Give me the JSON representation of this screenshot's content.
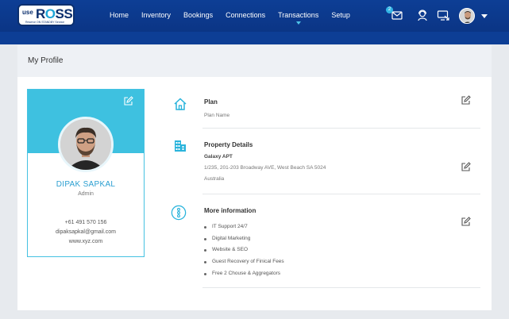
{
  "header": {
    "logo": {
      "use": "use",
      "brand_pre": "R",
      "brand_o": "O",
      "brand_post": "SS",
      "tagline": "Reserve ON STANDBY Service"
    },
    "nav": [
      "Home",
      "Inventory",
      "Bookings",
      "Connections",
      "Transactions",
      "Setup"
    ],
    "active_nav": "Transactions",
    "messages_badge": "2",
    "icons": [
      "mail-icon",
      "support-agent-icon",
      "screen-share-icon",
      "user-avatar",
      "dropdown-caret-icon"
    ]
  },
  "card": {
    "title": "My Profile"
  },
  "profile": {
    "name": "DIPAK SAPKAL",
    "role": "Admin",
    "phone": "+61 491 570 156",
    "email": "dipaksapkal@gmail.com",
    "website": "www.xyz.com"
  },
  "sections": {
    "plan": {
      "title": "Plan",
      "value": "Plan Name"
    },
    "property": {
      "title": "Property Details",
      "name": "Galaxy APT",
      "address1": "1/235, 201-203 Broadway AVE, West Beach SA 5024",
      "address2": "Australia"
    },
    "more": {
      "title": "More information",
      "items": [
        "IT Support 24/7",
        "Digital Marketing",
        "Website & SEO",
        "Guest Recovery of Finical Fees",
        "Free 2 Chouse & Aggregators"
      ]
    }
  },
  "colors": {
    "nav_bg": "#0d3e95",
    "accent": "#3ec1e0",
    "name": "#2b9fd1"
  }
}
